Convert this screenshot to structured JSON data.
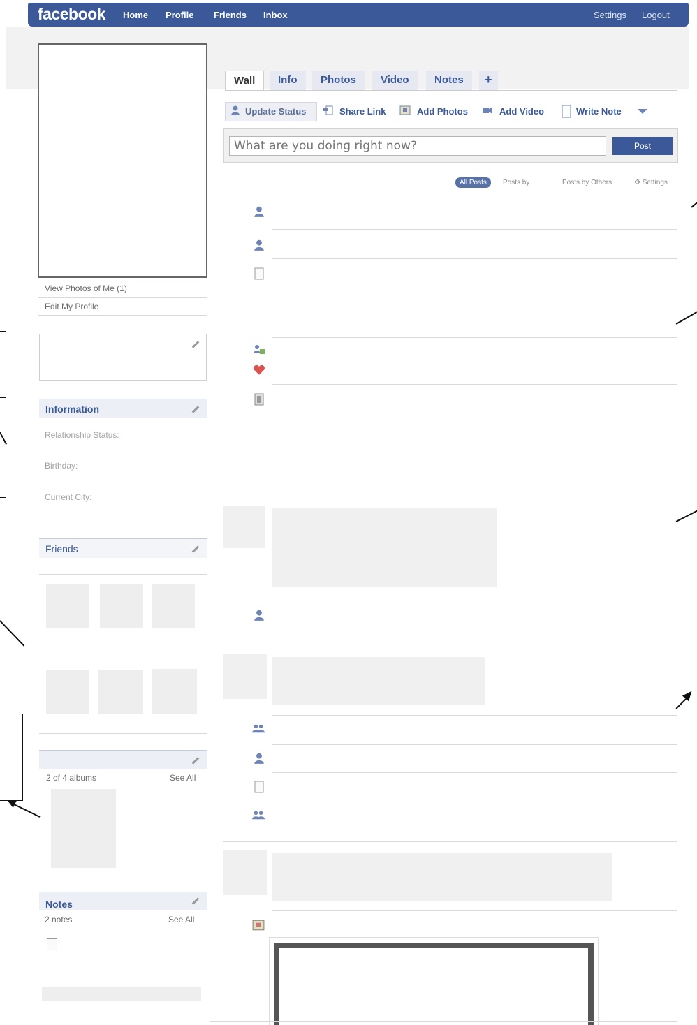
{
  "topbar": {
    "logo": "facebook",
    "nav": [
      "Home",
      "Profile",
      "Friends",
      "Inbox"
    ],
    "right": [
      "Settings",
      "Logout"
    ]
  },
  "left": {
    "view_photos": "View Photos of Me (1)",
    "edit_profile": "Edit My Profile",
    "information": {
      "title": "Information",
      "fields": [
        "Relationship Status:",
        "Birthday:",
        "Current City:"
      ]
    },
    "friends": {
      "title": "Friends"
    },
    "photos": {
      "count_label": "2 of 4 albums",
      "see_all": "See All"
    },
    "notes": {
      "title": "Notes",
      "count_label": "2 notes",
      "see_all": "See All"
    }
  },
  "tabs": [
    "Wall",
    "Info",
    "Photos",
    "Video",
    "Notes",
    "+"
  ],
  "publisher": {
    "items": [
      "Update Status",
      "Share Link",
      "Add Photos",
      "Add Video",
      "Write Note"
    ],
    "placeholder": "What are you doing right now?",
    "post_label": "Post"
  },
  "filters": [
    "All Posts",
    "Posts by",
    "Posts by Others",
    "Settings"
  ],
  "colors": {
    "brand": "#3b5998",
    "link": "#3b5998",
    "placeholder_bg": "#eeeeee"
  },
  "feed_icons": [
    "user-icon",
    "user-icon",
    "note-icon",
    "friends-add-icon",
    "heart-icon",
    "film-icon",
    "user-icon",
    "group-icon",
    "user-icon",
    "note-icon",
    "group-icon",
    "photo-icon"
  ]
}
